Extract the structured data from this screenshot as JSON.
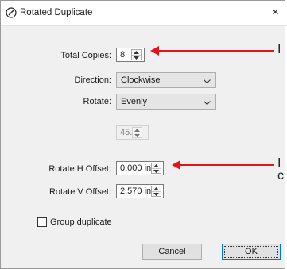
{
  "window": {
    "title": "Rotated Duplicate",
    "close_glyph": "×"
  },
  "form": {
    "total_copies": {
      "label": "Total Copies:",
      "value": "8"
    },
    "direction": {
      "label": "Direction:",
      "value": "Clockwise"
    },
    "rotate": {
      "label": "Rotate:",
      "value": "Evenly"
    },
    "angle": {
      "value": "45.00"
    },
    "rotate_h_offset": {
      "label": "Rotate H Offset:",
      "value": "0.000 in"
    },
    "rotate_v_offset": {
      "label": "Rotate V Offset:",
      "value": "2.570 in"
    },
    "group_duplicate": {
      "label": "Group duplicate",
      "checked": false
    }
  },
  "buttons": {
    "cancel": "Cancel",
    "ok": "OK"
  },
  "annotations": {
    "arrow_color": "#e3141b",
    "edge_text_1": "I",
    "edge_text_2": "I",
    "edge_text_3": "c"
  },
  "icons": {
    "title": "pen-icon",
    "close": "close-icon",
    "spinner": "spinner-arrows-icon",
    "dropdown": "chevron-down-icon"
  }
}
